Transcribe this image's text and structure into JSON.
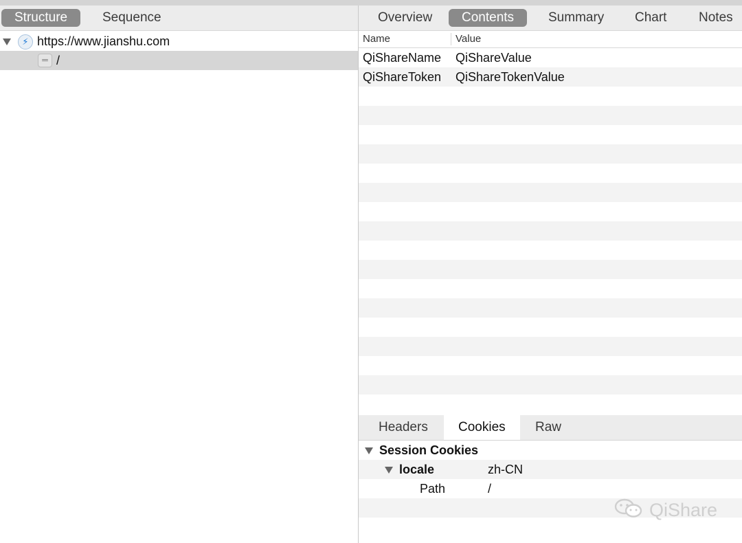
{
  "left_tabs": [
    "Structure",
    "Sequence"
  ],
  "tree": {
    "host": "https://www.jianshu.com",
    "path": "/"
  },
  "right_tabs": [
    "Overview",
    "Contents",
    "Summary",
    "Chart",
    "Notes"
  ],
  "table": {
    "columns": [
      "Name",
      "Value"
    ],
    "rows": [
      {
        "name": "QiShareName",
        "value": "QiShareValue"
      },
      {
        "name": "QiShareToken",
        "value": "QiShareTokenValue"
      }
    ]
  },
  "sub_tabs": [
    "Headers",
    "Cookies",
    "Raw"
  ],
  "cookies": {
    "group": "Session Cookies",
    "cookie_name": "locale",
    "cookie_value": "zh-CN",
    "attr_name": "Path",
    "attr_value": "/"
  },
  "watermark": "QiShare",
  "colors": {
    "active_tab": "#8a8a8a",
    "toolbar": "#ececec",
    "stripe": "#f3f3f3",
    "selected_row": "#d6d6d6"
  }
}
